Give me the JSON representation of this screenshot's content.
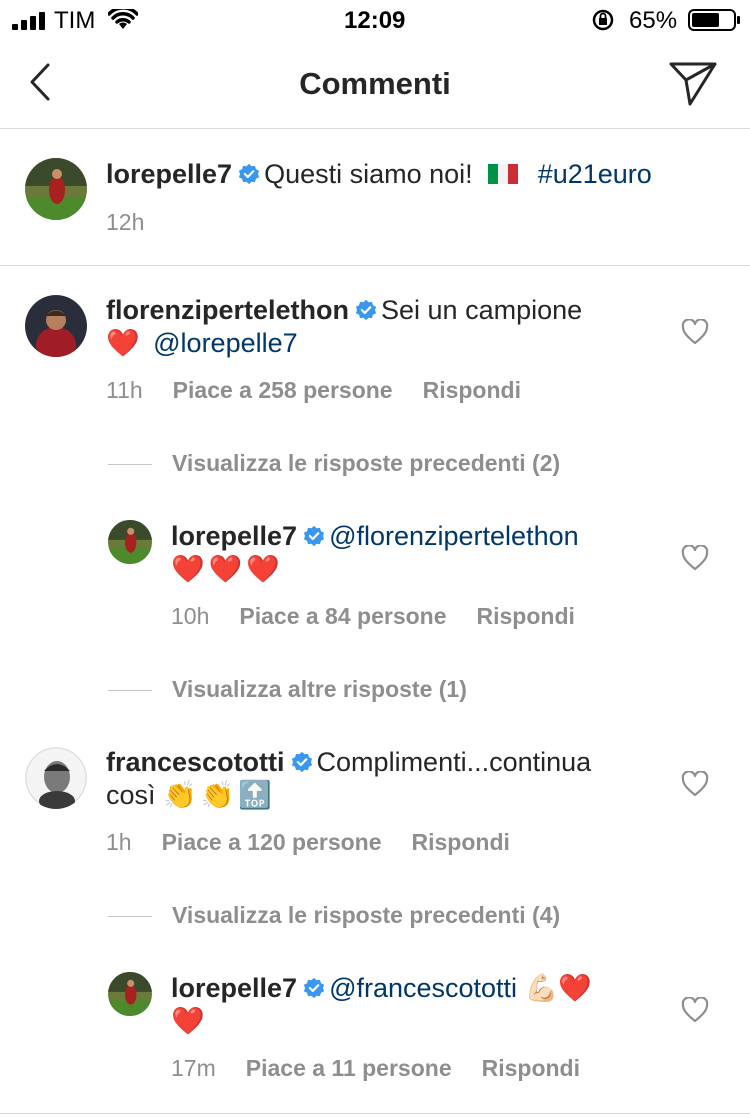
{
  "status_bar": {
    "carrier": "TIM",
    "time": "12:09",
    "battery": "65%"
  },
  "header": {
    "title": "Commenti"
  },
  "caption": {
    "username": "lorepelle7",
    "text": "Questi siamo noi!",
    "flag": "🇮🇹",
    "hashtag": "#u21euro",
    "time": "12h"
  },
  "comments": [
    {
      "username": "florenzipertelethon",
      "text": "Sei un campione",
      "emoji": "❤️",
      "mention": "@lorepelle7",
      "time": "11h",
      "likes": "Piace a 258 persone",
      "reply": "Rispondi",
      "view_replies": "Visualizza le risposte precedenti (2)"
    },
    {
      "username": "lorepelle7",
      "mention": "@florenzipertelethon",
      "emoji": "❤️❤️❤️",
      "time": "10h",
      "likes": "Piace a 84 persone",
      "reply": "Rispondi",
      "view_replies": "Visualizza altre risposte (1)"
    },
    {
      "username": "francescototti",
      "text": "Complimenti...continua",
      "text2": "così",
      "emoji": "👏👏🔝",
      "time": "1h",
      "likes": "Piace a 120 persone",
      "reply": "Rispondi",
      "view_replies": "Visualizza le risposte precedenti (4)"
    },
    {
      "username": "lorepelle7",
      "mention": "@francescototti",
      "emoji": "💪🏻❤️",
      "emoji2": "❤️",
      "time": "17m",
      "likes": "Piace a 11 persone",
      "reply": "Rispondi"
    }
  ],
  "colors": {
    "link": "#00376b",
    "verified": "#3897f0",
    "meta": "#8e8e8e"
  }
}
